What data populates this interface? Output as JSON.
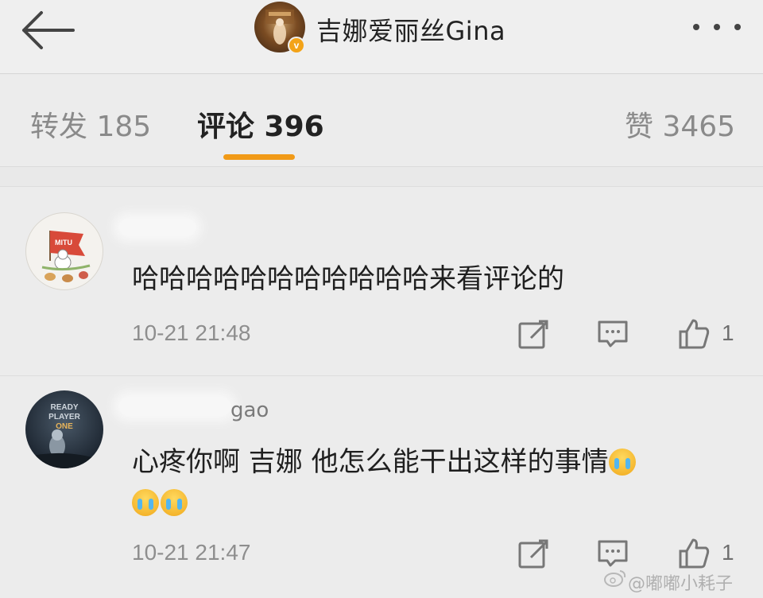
{
  "header": {
    "back_label": "",
    "title": "吉娜爱丽丝Gina",
    "verified_mark": "v"
  },
  "tabs": [
    {
      "label": "转发 185",
      "active": false
    },
    {
      "label": "评论 396",
      "active": true
    },
    {
      "label": "赞 3465",
      "active": false
    }
  ],
  "comments": [
    {
      "username": "",
      "text": "哈哈哈哈哈哈哈哈哈哈哈来看评论的",
      "time": "10-21 21:48",
      "likes": "1",
      "emojis": 0
    },
    {
      "username": "gao",
      "text": "心疼你啊 吉娜  他怎么能干出这样的事情",
      "time": "10-21 21:47",
      "likes": "1",
      "emojis": 3
    }
  ],
  "avatar_text": {
    "flag": "MITU",
    "ready": "READY",
    "player": "PLAYER",
    "one": "ONE"
  },
  "watermark": "@嘟嘟小耗子",
  "colors": {
    "accent": "#f19a17",
    "verified": "#f3a318",
    "background": "#ececec"
  }
}
